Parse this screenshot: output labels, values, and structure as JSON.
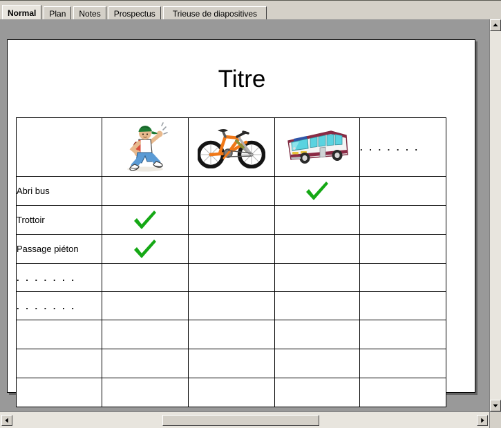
{
  "window": {
    "background_color": "#999999",
    "chrome_color": "#d4d0c8"
  },
  "tabstrip": {
    "tabs": [
      {
        "label": "Normal",
        "active": true
      },
      {
        "label": "Plan",
        "active": false
      },
      {
        "label": "Notes",
        "active": false
      },
      {
        "label": "Prospectus",
        "active": false
      },
      {
        "label": "Trieuse de diapositives",
        "active": false
      }
    ]
  },
  "slide": {
    "title": "Titre",
    "background_color": "#ffffff",
    "table": {
      "columns": [
        {
          "name": "row-label-column",
          "type": "text",
          "header": ""
        },
        {
          "name": "pedestrian-column",
          "type": "image",
          "header_icon": "running-boy-icon"
        },
        {
          "name": "bicycle-column",
          "type": "image",
          "header_icon": "bicycle-icon"
        },
        {
          "name": "bus-column",
          "type": "image",
          "header_icon": "bus-icon"
        },
        {
          "name": "other-column",
          "type": "dots",
          "header": ". . . . . . ."
        }
      ],
      "rows": [
        {
          "label": "Abri bus",
          "type": "label",
          "checks": [
            false,
            false,
            true,
            false
          ]
        },
        {
          "label": "Trottoir",
          "type": "label",
          "checks": [
            true,
            false,
            false,
            false
          ]
        },
        {
          "label": "Passage piéton",
          "type": "label",
          "checks": [
            true,
            false,
            false,
            false
          ]
        },
        {
          "label": ". . . . . . .",
          "type": "dots",
          "checks": [
            false,
            false,
            false,
            false
          ]
        },
        {
          "label": ". . . . . . .",
          "type": "dots",
          "checks": [
            false,
            false,
            false,
            false
          ]
        },
        {
          "label": "",
          "type": "blank",
          "checks": [
            false,
            false,
            false,
            false
          ]
        },
        {
          "label": "",
          "type": "blank",
          "checks": [
            false,
            false,
            false,
            false
          ]
        },
        {
          "label": "",
          "type": "blank",
          "checks": [
            false,
            false,
            false,
            false
          ]
        }
      ],
      "check_color": "#15a815",
      "border_color": "#000000"
    }
  },
  "scrollbars": {
    "vertical": {
      "up_arrow": "▲",
      "down_arrow": "▼"
    },
    "horizontal": {
      "left_arrow": "◀",
      "right_arrow": "▶"
    }
  }
}
